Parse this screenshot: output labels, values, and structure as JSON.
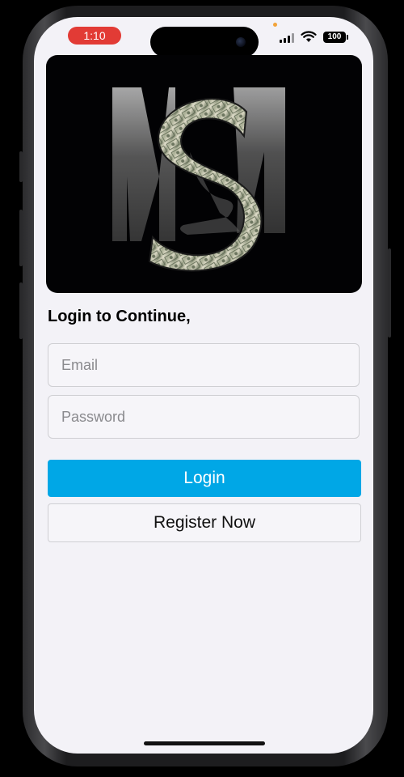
{
  "status_bar": {
    "time": "1:10",
    "battery": "100"
  },
  "hero": {
    "logo_alt": "MS logo"
  },
  "login": {
    "heading": "Login to Continue,",
    "email_placeholder": "Email",
    "password_placeholder": "Password",
    "login_label": "Login",
    "register_label": "Register Now"
  },
  "colors": {
    "primary": "#00a7e6",
    "background": "#f3f2f7",
    "recording_indicator": "#e23b35"
  }
}
